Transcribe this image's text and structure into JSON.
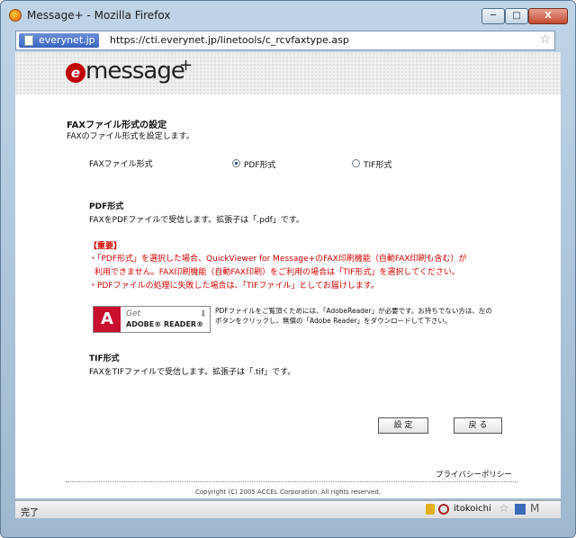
{
  "window": {
    "title": "Message+ - Mozilla Firefox",
    "min_label": "─",
    "max_label": "□",
    "close_label": "X"
  },
  "urlbar": {
    "site": "everynet.jp",
    "url": "https://cti.everynet.jp/linetools/c_rcvfaxtype.asp"
  },
  "logo": {
    "mark": "e",
    "text": "message",
    "plus": "+"
  },
  "section": {
    "title": "FAXファイル形式の設定",
    "description": "FAXのファイル形式を設定します。"
  },
  "format": {
    "label": "FAXファイル形式",
    "options": [
      {
        "label": "PDF形式",
        "checked": true
      },
      {
        "label": "TIF形式",
        "checked": false
      }
    ]
  },
  "pdf": {
    "heading": "PDF形式",
    "description": "FAXをPDFファイルで受信します。拡張子は「.pdf」です。"
  },
  "important": {
    "title": "【重要】",
    "lines": [
      "・「PDF形式」を選択した場合、QuickViewer for Message+のFAX印刷機能（自動FAX印刷も含む）が",
      "利用できません。FAX印刷機能（自動FAX印刷）をご利用の場合は「TIF形式」を選択してください。",
      "・PDFファイルの処理に失敗した場合は、「TIFファイル」としてお届けします。"
    ]
  },
  "adobe": {
    "get": "Get",
    "name": "ADOBE® READER®",
    "note": "PDFファイルをご覧頂くためには、「AdobeReader」が必要です。お持ちでない方は、左のボタンをクリックし、無償の「Adobe Reader」をダウンロードして下さい。"
  },
  "tif": {
    "heading": "TIF形式",
    "description": "FAXをTIFファイルで受信します。拡張子は「.tif」です。"
  },
  "buttons": {
    "set": "設 定",
    "back": "戻 る"
  },
  "footer": {
    "privacy": "プライバシーポリシー",
    "copyright": "Copyright (C) 2005 ACCEL Corporation. All rights reserved."
  },
  "statusbar": {
    "text": "完了",
    "user": "itokoichi"
  },
  "colors": {
    "important": "#d40000",
    "adobe_red": "#c8102e"
  }
}
